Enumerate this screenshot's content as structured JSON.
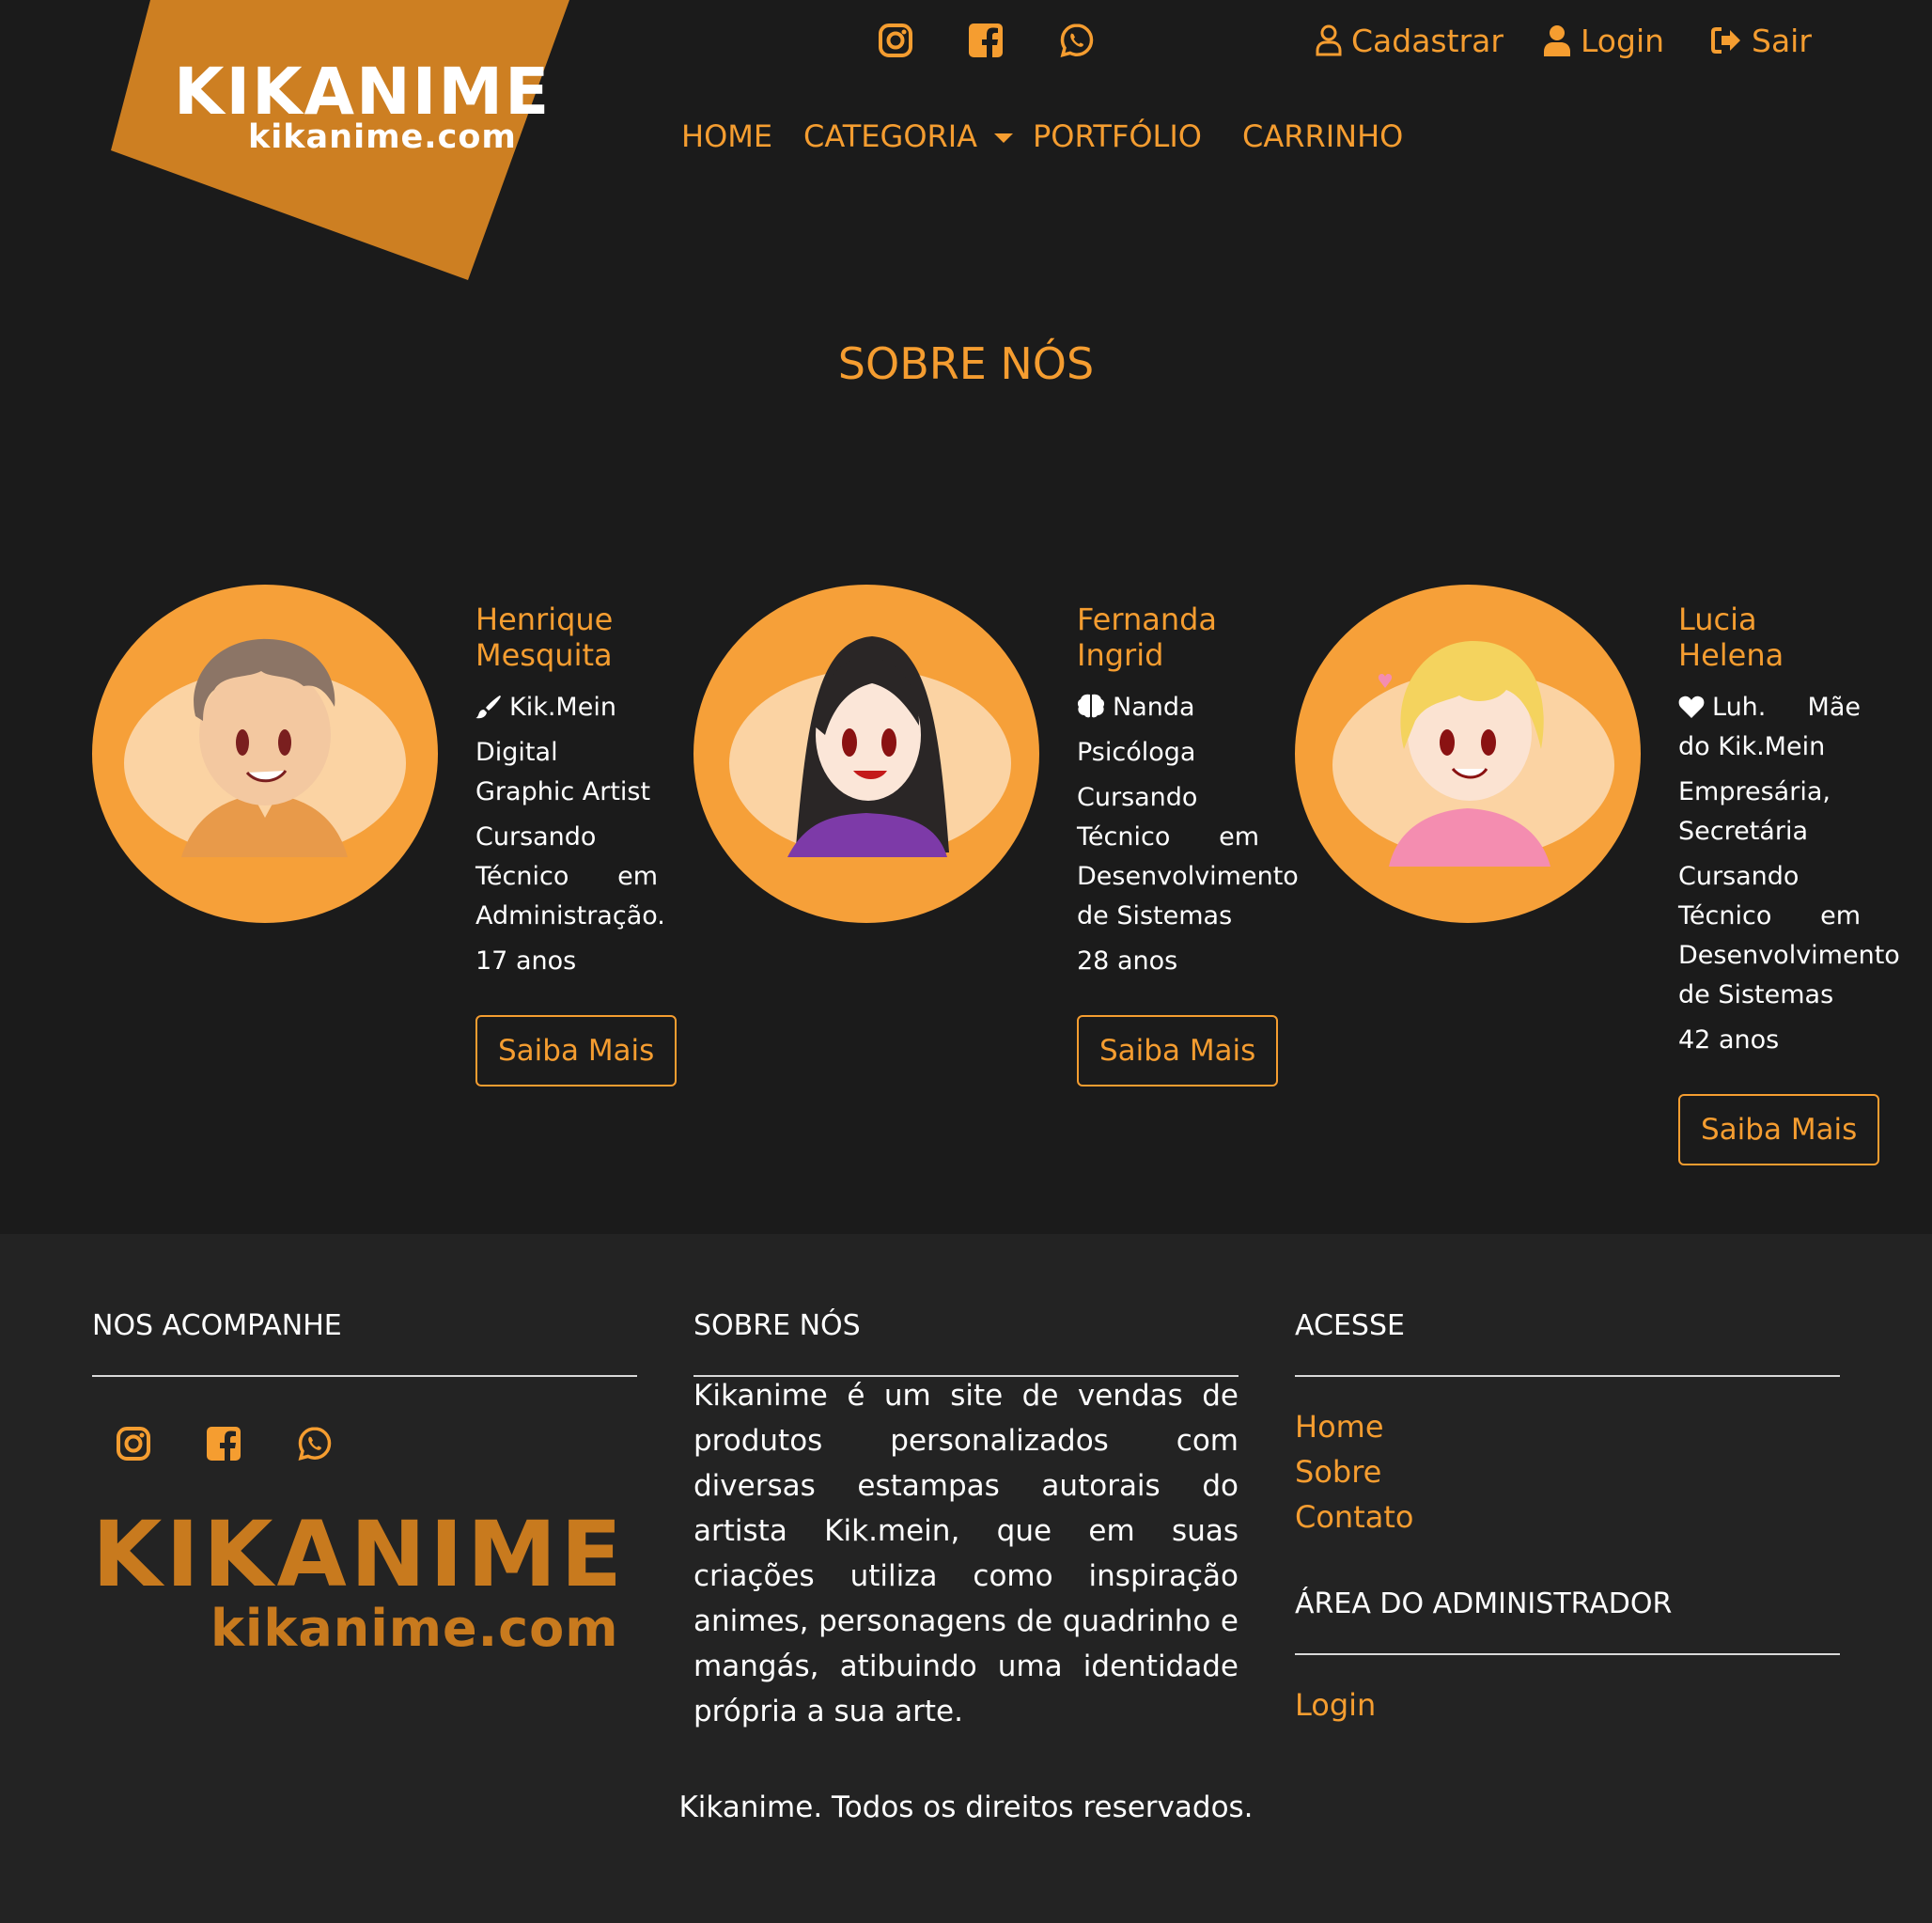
{
  "brand": {
    "name": "KIKANIME",
    "domain": "kikanime.com",
    "accent_color": "#f59d30",
    "logo_color": "#cd7f22",
    "background": "#1b1b1b",
    "footer_background": "#232323"
  },
  "header": {
    "social_icons": [
      "instagram-icon",
      "facebook-icon",
      "whatsapp-icon"
    ],
    "auth_links": [
      {
        "label": "Cadastrar",
        "icon": "user-outline-icon"
      },
      {
        "label": "Login",
        "icon": "user-solid-icon"
      },
      {
        "label": "Sair",
        "icon": "sign-out-icon"
      }
    ],
    "nav": [
      {
        "label": "HOME"
      },
      {
        "label": "CATEGORIA"
      },
      {
        "label": "PORTFÓLIO"
      },
      {
        "label": "CARRINHO"
      }
    ]
  },
  "main": {
    "title": "SOBRE NÓS",
    "members": [
      {
        "name": "Henrique Mesquita",
        "nickname": "Kik.Mein",
        "nickname_icon": "paint-brush-icon",
        "role": "Digital Graphic Artist",
        "study": "Cursando Técnico em Administração.",
        "age": "17 anos",
        "button": "Saiba Mais"
      },
      {
        "name": "Fernanda Ingrid",
        "nickname": "Nanda",
        "nickname_icon": "brain-icon",
        "role": "Psicóloga",
        "study": "Cursando Técnico em Desenvolvimento de Sistemas",
        "age": "28 anos",
        "button": "Saiba Mais"
      },
      {
        "name": "Lucia Helena",
        "nickname": "Luh. Mãe do Kik.Mein",
        "nickname_icon": "heart-icon",
        "role": "Empresária, Secretária",
        "study": "Cursando Técnico em Desenvolvimento de Sistemas",
        "age": "42 anos",
        "button": "Saiba Mais"
      }
    ]
  },
  "footer": {
    "follow_title": "NOS ACOMPANHE",
    "about_title": "SOBRE NÓS",
    "about_text": "Kikanime é um site de vendas de produtos personalizados com diversas estampas autorais do artista Kik.mein, que em suas criações utiliza como inspiração animes, personagens de quadrinho e mangás, atibuindo uma identidade própria a sua arte.",
    "access_title": "ACESSE",
    "access_links": [
      "Home",
      "Sobre",
      "Contato"
    ],
    "admin_title": "ÁREA DO ADMINISTRADOR",
    "admin_links": [
      "Login"
    ],
    "copyright": "Kikanime. Todos os direitos reservados."
  }
}
